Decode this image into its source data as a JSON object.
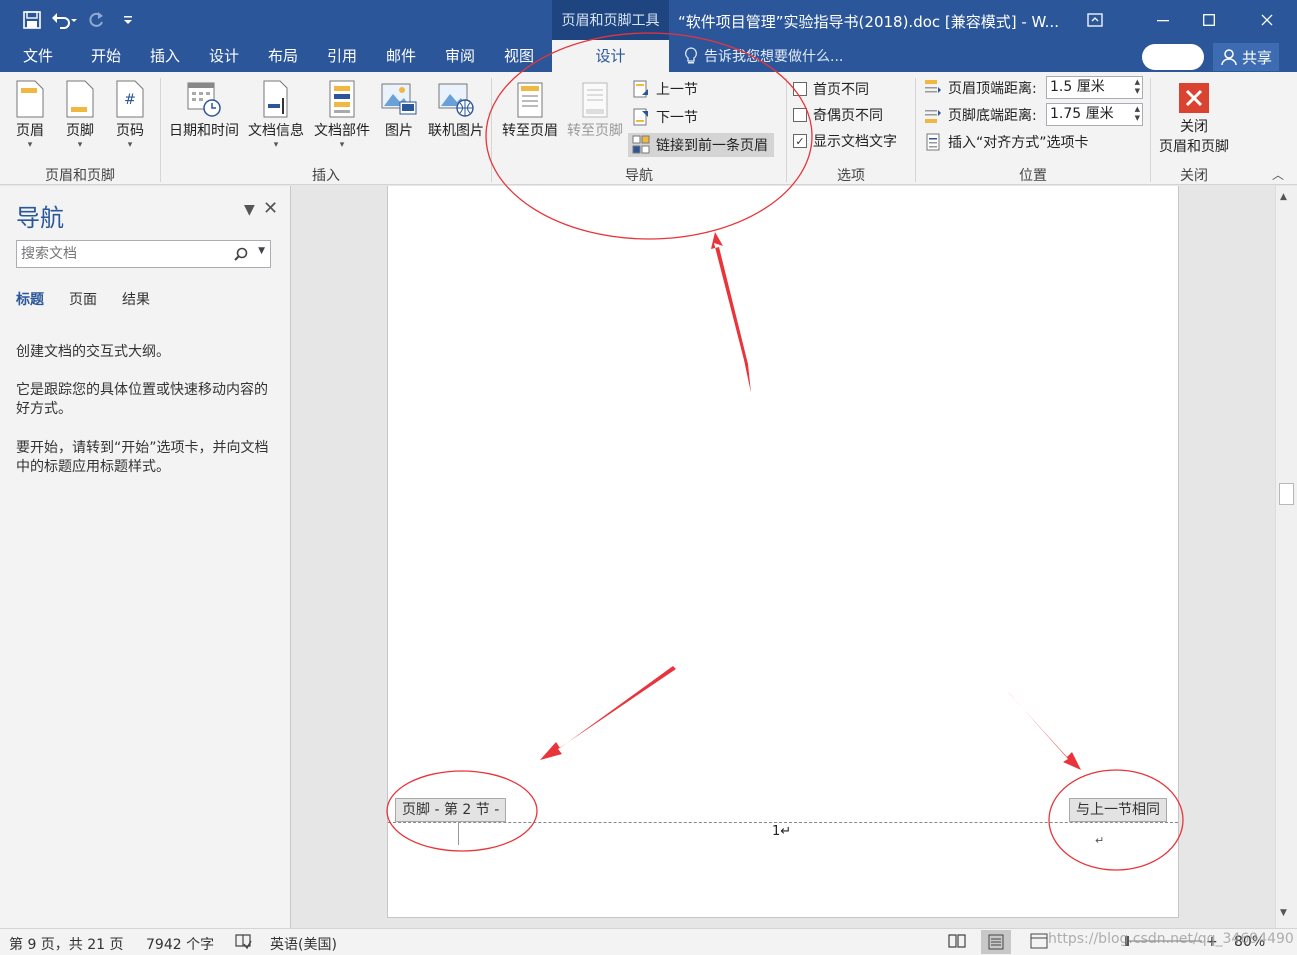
{
  "window": {
    "contextual_group": "页眉和页脚工具",
    "doc_title": "“软件项目管理”实验指导书(2018).doc [兼容模式] - W..."
  },
  "tabs": [
    {
      "label": "文件"
    },
    {
      "label": "开始"
    },
    {
      "label": "插入"
    },
    {
      "label": "设计"
    },
    {
      "label": "布局"
    },
    {
      "label": "引用"
    },
    {
      "label": "邮件"
    },
    {
      "label": "审阅"
    },
    {
      "label": "视图"
    },
    {
      "label": "设计"
    }
  ],
  "tellme": "告诉我您想要做什么...",
  "share": "共享",
  "ribbon": {
    "header_footer": {
      "label": "页眉和页脚",
      "header": "页眉",
      "footer": "页脚",
      "page_number": "页码"
    },
    "insert": {
      "label": "插入",
      "date_time": "日期和时间",
      "doc_info": "文档信息",
      "quick_parts": "文档部件",
      "pictures": "图片",
      "online_pictures": "联机图片"
    },
    "navigation": {
      "label": "导航",
      "goto_header": "转至页眉",
      "goto_footer": "转至页脚",
      "previous": "上一节",
      "next": "下一节",
      "link_previous": "链接到前一条页眉"
    },
    "options": {
      "label": "选项",
      "different_first": "首页不同",
      "different_odd_even": "奇偶页不同",
      "show_doc_text": "显示文档文字",
      "check": "✓"
    },
    "position": {
      "label": "位置",
      "header_from_top_label": "页眉顶端距离:",
      "header_from_top_value": "1.5 厘米",
      "footer_from_bottom_label": "页脚底端距离:",
      "footer_from_bottom_value": "1.75 厘米",
      "insert_alignment_tab": "插入“对齐方式”选项卡"
    },
    "close": {
      "label": "关闭",
      "close_line1": "关闭",
      "close_line2": "页眉和页脚"
    }
  },
  "nav": {
    "title": "导航",
    "search_placeholder": "搜索文档",
    "tabs": [
      "标题",
      "页面",
      "结果"
    ],
    "p1": "创建文档的交互式大纲。",
    "p2": "它是跟踪您的具体位置或快速移动内容的好方式。",
    "p3": "要开始，请转到“开始”选项卡，并向文档中的标题应用标题样式。"
  },
  "document": {
    "footer_tag": "页脚 - 第 2 节 -",
    "same_as_previous": "与上一节相同",
    "page_number": "1↵",
    "para_mark": "↵"
  },
  "status": {
    "page": "第 9 页，共 21 页",
    "words": "7942 个字",
    "language": "英语(美国)",
    "zoom": "80%",
    "watermark": "https://blog.csdn.net/qq_34694490"
  },
  "colors": {
    "brand": "#2b579a",
    "annotation_red": "#e8343a",
    "close_red": "#d9432f"
  }
}
